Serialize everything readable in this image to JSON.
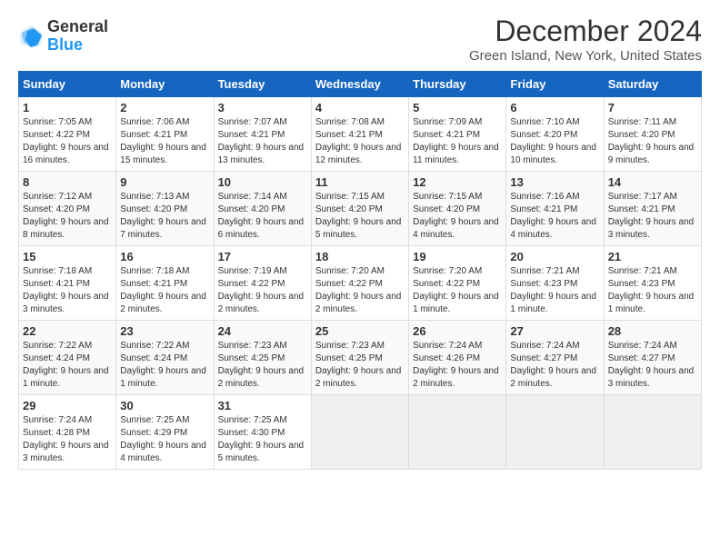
{
  "logo": {
    "line1": "General",
    "line2": "Blue"
  },
  "title": "December 2024",
  "subtitle": "Green Island, New York, United States",
  "headers": [
    "Sunday",
    "Monday",
    "Tuesday",
    "Wednesday",
    "Thursday",
    "Friday",
    "Saturday"
  ],
  "weeks": [
    [
      {
        "day": "1",
        "sunrise": "7:05 AM",
        "sunset": "4:22 PM",
        "daylight": "9 hours and 16 minutes."
      },
      {
        "day": "2",
        "sunrise": "7:06 AM",
        "sunset": "4:21 PM",
        "daylight": "9 hours and 15 minutes."
      },
      {
        "day": "3",
        "sunrise": "7:07 AM",
        "sunset": "4:21 PM",
        "daylight": "9 hours and 13 minutes."
      },
      {
        "day": "4",
        "sunrise": "7:08 AM",
        "sunset": "4:21 PM",
        "daylight": "9 hours and 12 minutes."
      },
      {
        "day": "5",
        "sunrise": "7:09 AM",
        "sunset": "4:21 PM",
        "daylight": "9 hours and 11 minutes."
      },
      {
        "day": "6",
        "sunrise": "7:10 AM",
        "sunset": "4:20 PM",
        "daylight": "9 hours and 10 minutes."
      },
      {
        "day": "7",
        "sunrise": "7:11 AM",
        "sunset": "4:20 PM",
        "daylight": "9 hours and 9 minutes."
      }
    ],
    [
      {
        "day": "8",
        "sunrise": "7:12 AM",
        "sunset": "4:20 PM",
        "daylight": "9 hours and 8 minutes."
      },
      {
        "day": "9",
        "sunrise": "7:13 AM",
        "sunset": "4:20 PM",
        "daylight": "9 hours and 7 minutes."
      },
      {
        "day": "10",
        "sunrise": "7:14 AM",
        "sunset": "4:20 PM",
        "daylight": "9 hours and 6 minutes."
      },
      {
        "day": "11",
        "sunrise": "7:15 AM",
        "sunset": "4:20 PM",
        "daylight": "9 hours and 5 minutes."
      },
      {
        "day": "12",
        "sunrise": "7:15 AM",
        "sunset": "4:20 PM",
        "daylight": "9 hours and 4 minutes."
      },
      {
        "day": "13",
        "sunrise": "7:16 AM",
        "sunset": "4:21 PM",
        "daylight": "9 hours and 4 minutes."
      },
      {
        "day": "14",
        "sunrise": "7:17 AM",
        "sunset": "4:21 PM",
        "daylight": "9 hours and 3 minutes."
      }
    ],
    [
      {
        "day": "15",
        "sunrise": "7:18 AM",
        "sunset": "4:21 PM",
        "daylight": "9 hours and 3 minutes."
      },
      {
        "day": "16",
        "sunrise": "7:18 AM",
        "sunset": "4:21 PM",
        "daylight": "9 hours and 2 minutes."
      },
      {
        "day": "17",
        "sunrise": "7:19 AM",
        "sunset": "4:22 PM",
        "daylight": "9 hours and 2 minutes."
      },
      {
        "day": "18",
        "sunrise": "7:20 AM",
        "sunset": "4:22 PM",
        "daylight": "9 hours and 2 minutes."
      },
      {
        "day": "19",
        "sunrise": "7:20 AM",
        "sunset": "4:22 PM",
        "daylight": "9 hours and 1 minute."
      },
      {
        "day": "20",
        "sunrise": "7:21 AM",
        "sunset": "4:23 PM",
        "daylight": "9 hours and 1 minute."
      },
      {
        "day": "21",
        "sunrise": "7:21 AM",
        "sunset": "4:23 PM",
        "daylight": "9 hours and 1 minute."
      }
    ],
    [
      {
        "day": "22",
        "sunrise": "7:22 AM",
        "sunset": "4:24 PM",
        "daylight": "9 hours and 1 minute."
      },
      {
        "day": "23",
        "sunrise": "7:22 AM",
        "sunset": "4:24 PM",
        "daylight": "9 hours and 1 minute."
      },
      {
        "day": "24",
        "sunrise": "7:23 AM",
        "sunset": "4:25 PM",
        "daylight": "9 hours and 2 minutes."
      },
      {
        "day": "25",
        "sunrise": "7:23 AM",
        "sunset": "4:25 PM",
        "daylight": "9 hours and 2 minutes."
      },
      {
        "day": "26",
        "sunrise": "7:24 AM",
        "sunset": "4:26 PM",
        "daylight": "9 hours and 2 minutes."
      },
      {
        "day": "27",
        "sunrise": "7:24 AM",
        "sunset": "4:27 PM",
        "daylight": "9 hours and 2 minutes."
      },
      {
        "day": "28",
        "sunrise": "7:24 AM",
        "sunset": "4:27 PM",
        "daylight": "9 hours and 3 minutes."
      }
    ],
    [
      {
        "day": "29",
        "sunrise": "7:24 AM",
        "sunset": "4:28 PM",
        "daylight": "9 hours and 3 minutes."
      },
      {
        "day": "30",
        "sunrise": "7:25 AM",
        "sunset": "4:29 PM",
        "daylight": "9 hours and 4 minutes."
      },
      {
        "day": "31",
        "sunrise": "7:25 AM",
        "sunset": "4:30 PM",
        "daylight": "9 hours and 5 minutes."
      },
      null,
      null,
      null,
      null
    ]
  ],
  "labels": {
    "sunrise": "Sunrise:",
    "sunset": "Sunset:",
    "daylight": "Daylight:"
  }
}
